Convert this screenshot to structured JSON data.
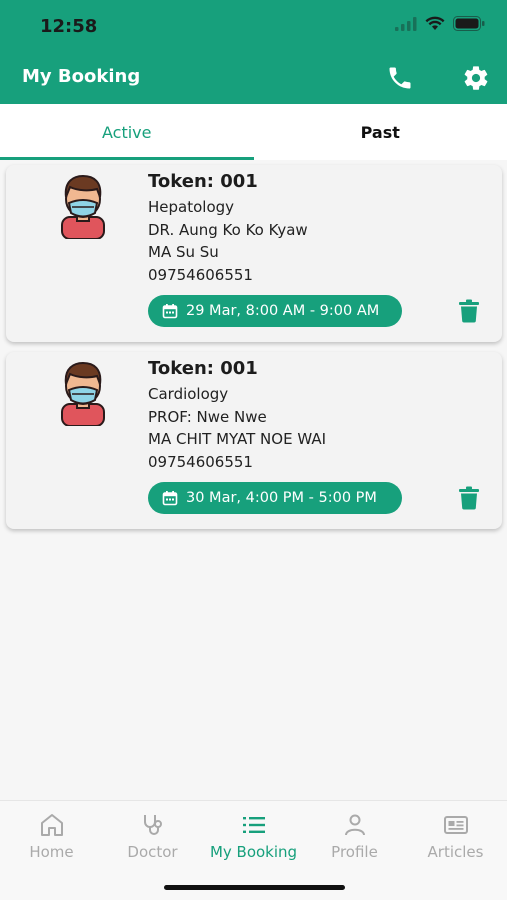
{
  "status_bar": {
    "time": "12:58"
  },
  "header": {
    "title": "My Booking",
    "icons": [
      "phone-icon",
      "gear-icon"
    ]
  },
  "tabs": [
    {
      "label": "Active",
      "active": true
    },
    {
      "label": "Past",
      "active": false
    }
  ],
  "bookings": [
    {
      "token": "Token: 001",
      "department": "Hepatology",
      "doctor": "DR. Aung Ko Ko Kyaw",
      "patient": "MA Su Su",
      "phone": "09754606551",
      "time_slot": "29 Mar, 8:00 AM - 9:00 AM"
    },
    {
      "token": "Token: 001",
      "department": "Cardiology",
      "doctor": "PROF: Nwe Nwe",
      "patient": "MA CHIT MYAT NOE WAI",
      "phone": "09754606551",
      "time_slot": "30 Mar, 4:00 PM - 5:00 PM"
    }
  ],
  "bottom_nav": [
    {
      "label": "Home",
      "icon": "home-icon",
      "active": false
    },
    {
      "label": "Doctor",
      "icon": "stethoscope-icon",
      "active": false
    },
    {
      "label": "My Booking",
      "icon": "list-icon",
      "active": true
    },
    {
      "label": "Profile",
      "icon": "person-icon",
      "active": false
    },
    {
      "label": "Articles",
      "icon": "newspaper-icon",
      "active": false
    }
  ],
  "colors": {
    "primary": "#17a07c",
    "inactive": "#aaaaaa"
  }
}
